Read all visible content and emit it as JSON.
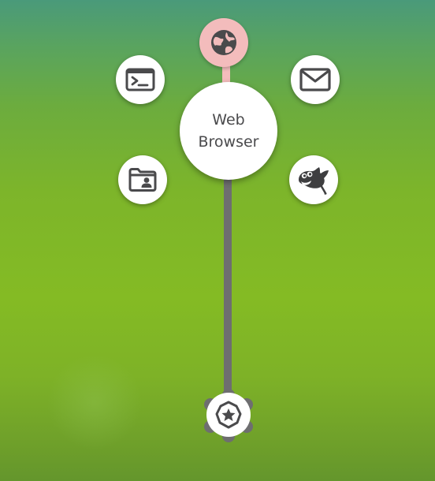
{
  "menu": {
    "selected_item_label": "Web Browser",
    "items": [
      {
        "id": "web-browser",
        "icon": "globe-icon",
        "state": "hovered",
        "highlight_color": "#f3bcbc"
      },
      {
        "id": "terminal",
        "icon": "terminal-icon"
      },
      {
        "id": "mail",
        "icon": "envelope-icon"
      },
      {
        "id": "contacts",
        "icon": "contact-folder-icon"
      },
      {
        "id": "gimp",
        "icon": "gimp-icon"
      }
    ],
    "root_icon": "star-badge-icon",
    "stroke_color": "#6e6e70"
  },
  "background": {
    "top_color": "#4a9a7a",
    "bottom_color": "#7eb227"
  }
}
